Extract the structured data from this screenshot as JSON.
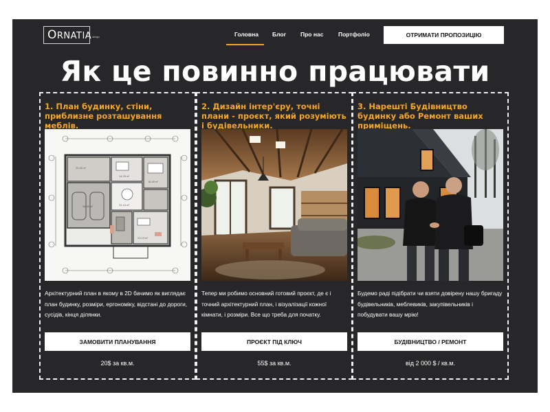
{
  "logo": {
    "text_first": "O",
    "text_rest": "RNATIA",
    "sub": "design"
  },
  "nav": {
    "items": [
      {
        "label": "Головна",
        "active": true
      },
      {
        "label": "Блог"
      },
      {
        "label": "Про нас"
      },
      {
        "label": "Портфоліо"
      }
    ],
    "cta_label": "Отримати пропозицію"
  },
  "page_title": "Як це повинно працювати",
  "colors": {
    "accent": "#f5a623",
    "background": "#272628",
    "text": "#ffffff"
  },
  "cards": [
    {
      "heading": "1. План будинку, стіни, приблизне розташування меблів.",
      "image": "floor-plan-drawing",
      "text": "Архітектурний план в якому в 2D бачимо як виглядає план будинку, розміри, ергономіку, відстані до дороги, сусідів, кінця ділянки.",
      "button_label": "Замовити планування",
      "price": "20$ за кв.м."
    },
    {
      "heading": "2. Дизайн інтер'єру, точні плани - проєкт, який розуміють і будівельники.",
      "image": "interior-living-room-render",
      "text": "Тепер ми робимо основний готовий проєкт, де є і точний архітектурний план, і візуалізації кожної кімнати, і розміри. Все що треба для початку.",
      "button_label": "Проєкт під ключ",
      "price": "55$ за кв.м."
    },
    {
      "heading": "3. Нарешті Будівництво будинку або Ремонт ваших приміщень.",
      "image": "house-exterior-builders-photo",
      "text": "Будемо раді підібрати чи взяти довірену нашу бригаду будівельників, меблевиків, закупівельників і побудувати вашу мрію!",
      "button_label": "Будівництво / ремонт",
      "price": "від 2 000 $ / кв.м."
    }
  ]
}
